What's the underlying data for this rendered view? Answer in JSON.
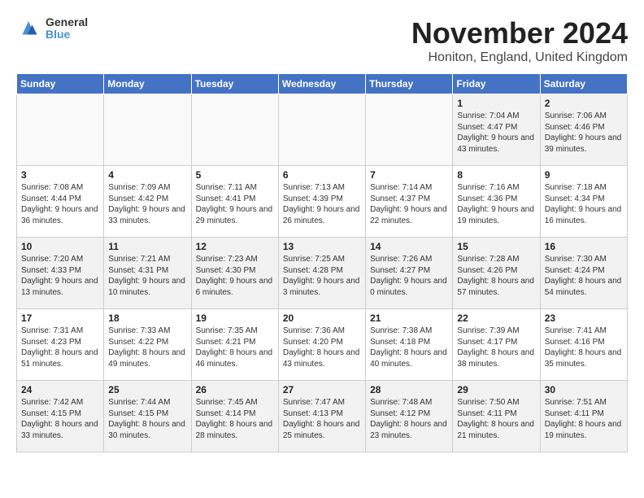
{
  "logo": {
    "general": "General",
    "blue": "Blue"
  },
  "title": "November 2024",
  "location": "Honiton, England, United Kingdom",
  "weekdays": [
    "Sunday",
    "Monday",
    "Tuesday",
    "Wednesday",
    "Thursday",
    "Friday",
    "Saturday"
  ],
  "weeks": [
    [
      {
        "day": "",
        "info": ""
      },
      {
        "day": "",
        "info": ""
      },
      {
        "day": "",
        "info": ""
      },
      {
        "day": "",
        "info": ""
      },
      {
        "day": "",
        "info": ""
      },
      {
        "day": "1",
        "info": "Sunrise: 7:04 AM\nSunset: 4:47 PM\nDaylight: 9 hours\nand 43 minutes."
      },
      {
        "day": "2",
        "info": "Sunrise: 7:06 AM\nSunset: 4:46 PM\nDaylight: 9 hours\nand 39 minutes."
      }
    ],
    [
      {
        "day": "3",
        "info": "Sunrise: 7:08 AM\nSunset: 4:44 PM\nDaylight: 9 hours\nand 36 minutes."
      },
      {
        "day": "4",
        "info": "Sunrise: 7:09 AM\nSunset: 4:42 PM\nDaylight: 9 hours\nand 33 minutes."
      },
      {
        "day": "5",
        "info": "Sunrise: 7:11 AM\nSunset: 4:41 PM\nDaylight: 9 hours\nand 29 minutes."
      },
      {
        "day": "6",
        "info": "Sunrise: 7:13 AM\nSunset: 4:39 PM\nDaylight: 9 hours\nand 26 minutes."
      },
      {
        "day": "7",
        "info": "Sunrise: 7:14 AM\nSunset: 4:37 PM\nDaylight: 9 hours\nand 22 minutes."
      },
      {
        "day": "8",
        "info": "Sunrise: 7:16 AM\nSunset: 4:36 PM\nDaylight: 9 hours\nand 19 minutes."
      },
      {
        "day": "9",
        "info": "Sunrise: 7:18 AM\nSunset: 4:34 PM\nDaylight: 9 hours\nand 16 minutes."
      }
    ],
    [
      {
        "day": "10",
        "info": "Sunrise: 7:20 AM\nSunset: 4:33 PM\nDaylight: 9 hours\nand 13 minutes."
      },
      {
        "day": "11",
        "info": "Sunrise: 7:21 AM\nSunset: 4:31 PM\nDaylight: 9 hours\nand 10 minutes."
      },
      {
        "day": "12",
        "info": "Sunrise: 7:23 AM\nSunset: 4:30 PM\nDaylight: 9 hours\nand 6 minutes."
      },
      {
        "day": "13",
        "info": "Sunrise: 7:25 AM\nSunset: 4:28 PM\nDaylight: 9 hours\nand 3 minutes."
      },
      {
        "day": "14",
        "info": "Sunrise: 7:26 AM\nSunset: 4:27 PM\nDaylight: 9 hours\nand 0 minutes."
      },
      {
        "day": "15",
        "info": "Sunrise: 7:28 AM\nSunset: 4:26 PM\nDaylight: 8 hours\nand 57 minutes."
      },
      {
        "day": "16",
        "info": "Sunrise: 7:30 AM\nSunset: 4:24 PM\nDaylight: 8 hours\nand 54 minutes."
      }
    ],
    [
      {
        "day": "17",
        "info": "Sunrise: 7:31 AM\nSunset: 4:23 PM\nDaylight: 8 hours\nand 51 minutes."
      },
      {
        "day": "18",
        "info": "Sunrise: 7:33 AM\nSunset: 4:22 PM\nDaylight: 8 hours\nand 49 minutes."
      },
      {
        "day": "19",
        "info": "Sunrise: 7:35 AM\nSunset: 4:21 PM\nDaylight: 8 hours\nand 46 minutes."
      },
      {
        "day": "20",
        "info": "Sunrise: 7:36 AM\nSunset: 4:20 PM\nDaylight: 8 hours\nand 43 minutes."
      },
      {
        "day": "21",
        "info": "Sunrise: 7:38 AM\nSunset: 4:18 PM\nDaylight: 8 hours\nand 40 minutes."
      },
      {
        "day": "22",
        "info": "Sunrise: 7:39 AM\nSunset: 4:17 PM\nDaylight: 8 hours\nand 38 minutes."
      },
      {
        "day": "23",
        "info": "Sunrise: 7:41 AM\nSunset: 4:16 PM\nDaylight: 8 hours\nand 35 minutes."
      }
    ],
    [
      {
        "day": "24",
        "info": "Sunrise: 7:42 AM\nSunset: 4:15 PM\nDaylight: 8 hours\nand 33 minutes."
      },
      {
        "day": "25",
        "info": "Sunrise: 7:44 AM\nSunset: 4:15 PM\nDaylight: 8 hours\nand 30 minutes."
      },
      {
        "day": "26",
        "info": "Sunrise: 7:45 AM\nSunset: 4:14 PM\nDaylight: 8 hours\nand 28 minutes."
      },
      {
        "day": "27",
        "info": "Sunrise: 7:47 AM\nSunset: 4:13 PM\nDaylight: 8 hours\nand 25 minutes."
      },
      {
        "day": "28",
        "info": "Sunrise: 7:48 AM\nSunset: 4:12 PM\nDaylight: 8 hours\nand 23 minutes."
      },
      {
        "day": "29",
        "info": "Sunrise: 7:50 AM\nSunset: 4:11 PM\nDaylight: 8 hours\nand 21 minutes."
      },
      {
        "day": "30",
        "info": "Sunrise: 7:51 AM\nSunset: 4:11 PM\nDaylight: 8 hours\nand 19 minutes."
      }
    ]
  ]
}
